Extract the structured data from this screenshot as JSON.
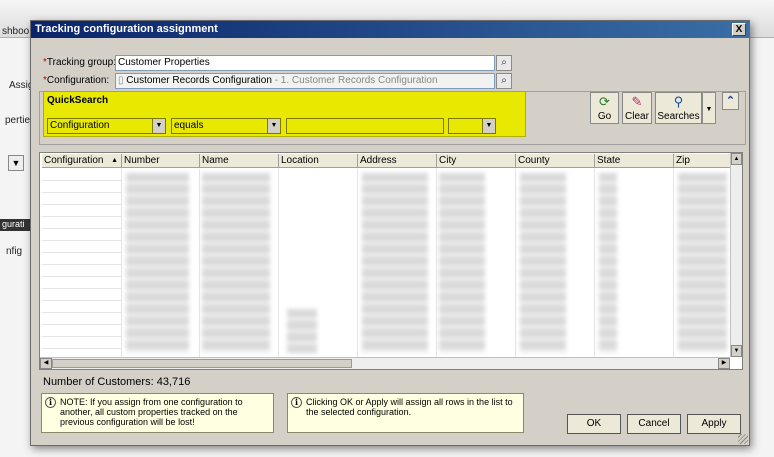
{
  "background": {
    "fragments": {
      "dashboard": "shboo",
      "assign": "Assig",
      "properties": "pertie",
      "config_bar": "gurati",
      "config": "nfig"
    }
  },
  "dialog": {
    "title": "Tracking configuration assignment",
    "close_label": "X",
    "tracking_group": {
      "label": "Tracking group:",
      "required_mark": "*",
      "value": "Customer Properties"
    },
    "configuration": {
      "label": "Configuration:",
      "required_mark": "*",
      "value": "Customer Records Configuration",
      "suffix": " - 1. Customer Records Configuration"
    },
    "quicksearch": {
      "title": "QuickSearch",
      "field_value": "Configuration",
      "operator_value": "equals",
      "search_value": "",
      "extra_value": ""
    },
    "toolbar": {
      "go_label": "Go",
      "clear_label": "Clear",
      "searches_label": "Searches"
    },
    "grid": {
      "columns": [
        "Configuration",
        "Number",
        "Name",
        "Location",
        "Address",
        "City",
        "County",
        "State",
        "Zip"
      ],
      "sort_indicator": "▲"
    },
    "count_text": "Number of Customers: 43,716",
    "note_left": "NOTE: If you assign from one configuration to another, all custom properties tracked on the previous configuration will be lost!",
    "note_right": "Clicking OK or Apply will assign all rows in the list to the selected configuration.",
    "buttons": {
      "ok": "OK",
      "cancel": "Cancel",
      "apply": "Apply"
    }
  },
  "colors": {
    "highlight": "#e8e800",
    "title_bar": "#0a246a",
    "note_bg": "#ffffe1"
  }
}
